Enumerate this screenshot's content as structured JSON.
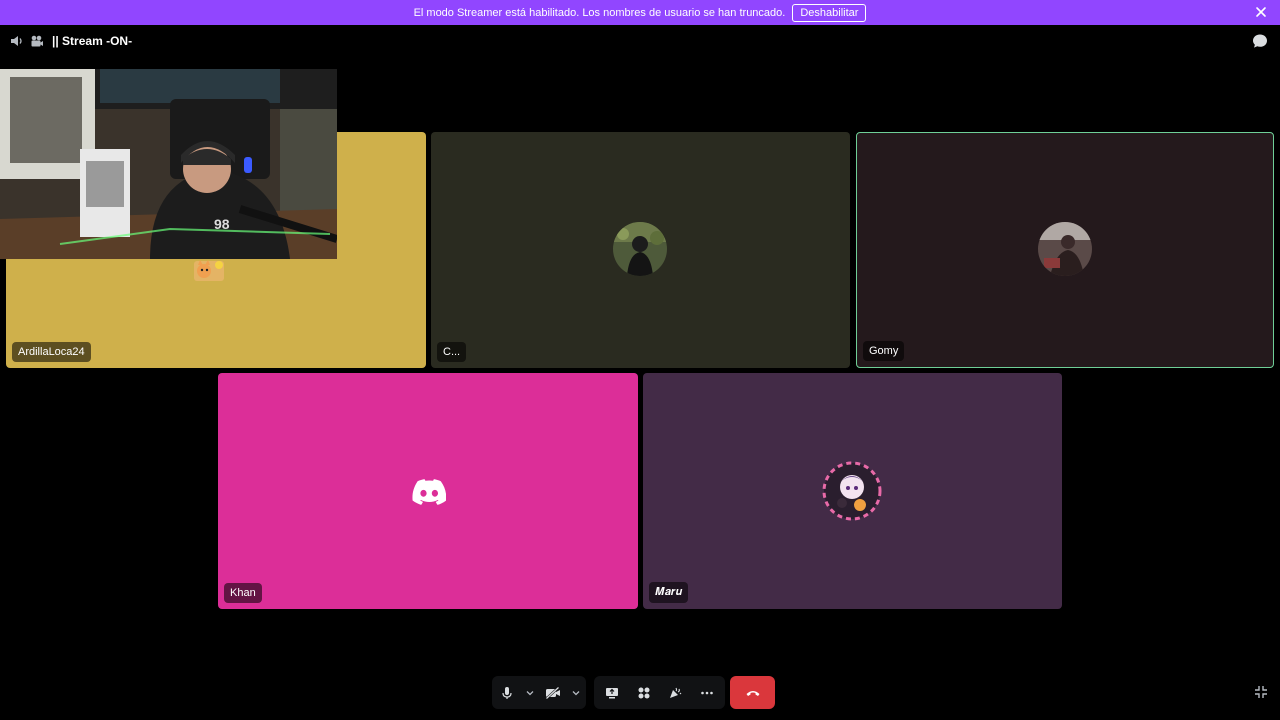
{
  "banner": {
    "text": "El modo Streamer está habilitado. Los nombres de usuario se han truncado.",
    "disable_label": "Deshabilitar",
    "color": "#9146ff"
  },
  "header": {
    "channel_title": "|| Stream -ON-"
  },
  "tiles": [
    {
      "name": "ArdillaLoca24",
      "bg": "#cfb04b",
      "avatar": "cat-emoji"
    },
    {
      "name": "C...",
      "bg": "#2a2b20",
      "avatar": "user-photo"
    },
    {
      "name": "Gomy",
      "bg": "#24191c",
      "avatar": "user-photo",
      "speaking": true
    },
    {
      "name": "Khan",
      "bg": "#dc2e98",
      "avatar": "discord-logo"
    },
    {
      "name": "𝑴𝒂𝒓𝒖",
      "bg": "#432b47",
      "avatar": "anime-avatar"
    }
  ],
  "controls": {
    "icons": [
      "microphone-icon",
      "chevron-down-icon",
      "camera-off-icon",
      "chevron-down-icon",
      "screen-share-icon",
      "activities-icon",
      "soundboard-icon",
      "more-icon",
      "hang-up-icon"
    ],
    "hangup_color": "#da373c"
  }
}
